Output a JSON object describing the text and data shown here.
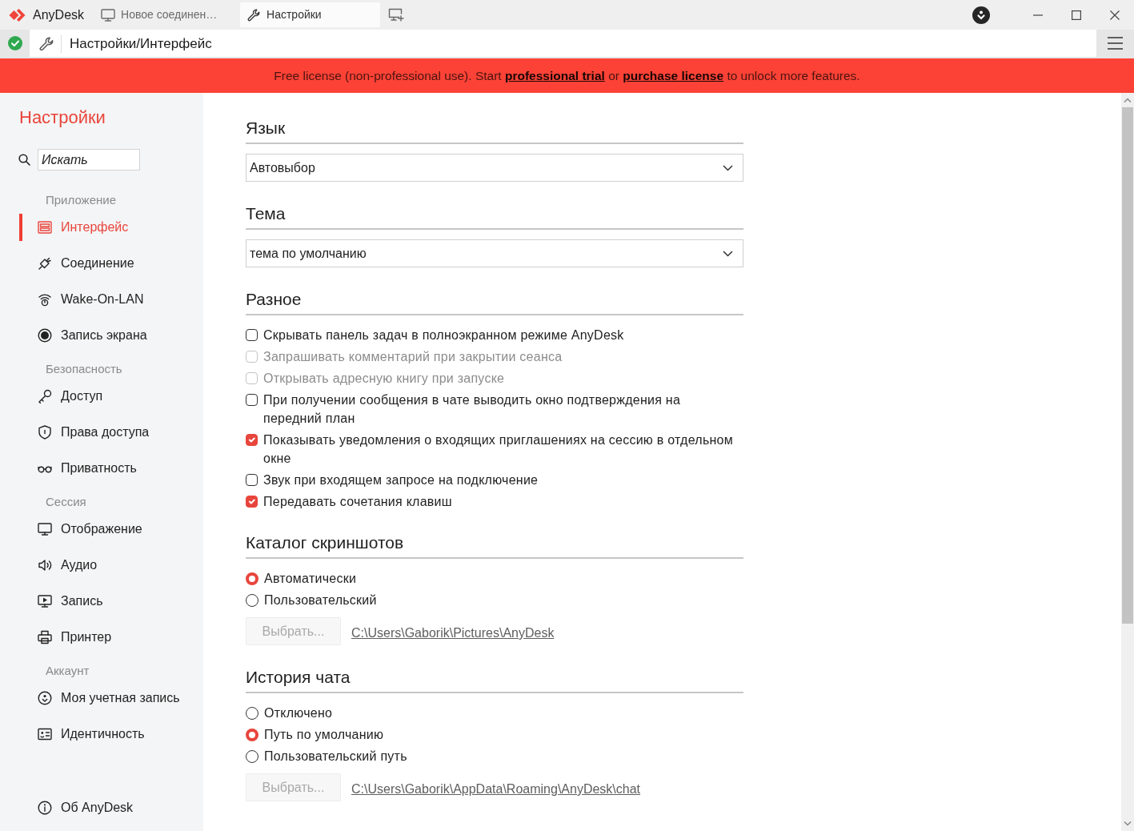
{
  "title_bar": {
    "app_name": "AnyDesk",
    "tabs": [
      {
        "label": "Новое соединен…",
        "selected": false
      },
      {
        "label": "Настройки",
        "selected": true
      }
    ]
  },
  "address_bar": {
    "path": "Настройки/Интерфейс"
  },
  "license_banner": [
    {
      "kind": "text",
      "text": "Free license (non-professional use). Start"
    },
    {
      "kind": "link",
      "text": "professional trial"
    },
    {
      "kind": "text",
      "text": "or"
    },
    {
      "kind": "link",
      "text": "purchase license"
    },
    {
      "kind": "text",
      "text": "to unlock more features."
    }
  ],
  "sidebar": {
    "title": "Настройки",
    "search": {
      "placeholder": "Искать"
    },
    "groups": [
      {
        "label": "Приложение",
        "items": [
          {
            "label": "Интерфейс",
            "selected": true
          },
          {
            "label": "Соединение",
            "selected": false
          },
          {
            "label": "Wake-On-LAN",
            "selected": false
          },
          {
            "label": "Запись экрана",
            "selected": false
          }
        ]
      },
      {
        "label": "Безопасность",
        "items": [
          {
            "label": "Доступ",
            "selected": false
          },
          {
            "label": "Права доступа",
            "selected": false
          },
          {
            "label": "Приватность",
            "selected": false
          }
        ]
      },
      {
        "label": "Сессия",
        "items": [
          {
            "label": "Отображение",
            "selected": false
          },
          {
            "label": "Аудио",
            "selected": false
          },
          {
            "label": "Запись",
            "selected": false
          },
          {
            "label": "Принтер",
            "selected": false
          }
        ]
      },
      {
        "label": "Аккаунт",
        "items": [
          {
            "label": "Моя учетная запись",
            "selected": false
          },
          {
            "label": "Идентичность",
            "selected": false
          }
        ]
      }
    ],
    "footer_item": {
      "label": "Об AnyDesk",
      "selected": false
    }
  },
  "sections": [
    {
      "kind": "dropdown",
      "heading": "Язык",
      "value": "Автовыбор"
    },
    {
      "kind": "dropdown",
      "heading": "Тема",
      "value": "тема по умолчанию"
    },
    {
      "kind": "checkboxes",
      "heading": "Разное",
      "options": [
        {
          "label": "Скрывать панель задач в полноэкранном режиме AnyDesk",
          "checked": false,
          "disabled": false
        },
        {
          "label": "Запрашивать комментарий при закрытии сеанса",
          "checked": false,
          "disabled": true
        },
        {
          "label": "Открывать адресную книгу при запуске",
          "checked": false,
          "disabled": true
        },
        {
          "label": "При получении сообщения в чате выводить окно подтверждения на передний план",
          "checked": false,
          "disabled": false
        },
        {
          "label": "Показывать уведомления о входящих приглашениях на сессию в отдельном окне",
          "checked": true,
          "disabled": false
        },
        {
          "label": "Звук при входящем запросе на подключение",
          "checked": false,
          "disabled": false
        },
        {
          "label": "Передавать сочетания клавиш",
          "checked": true,
          "disabled": false
        }
      ]
    },
    {
      "kind": "radios",
      "heading": "Каталог скриншотов",
      "options": [
        {
          "label": "Автоматически",
          "selected": true
        },
        {
          "label": "Пользовательский",
          "selected": false
        }
      ],
      "browse_button": {
        "label": "Выбрать...",
        "disabled": true
      },
      "path": "C:\\Users\\Gaborik\\Pictures\\AnyDesk"
    },
    {
      "kind": "radios",
      "heading": "История чата",
      "options": [
        {
          "label": "Отключено",
          "selected": false
        },
        {
          "label": "Путь по умолчанию",
          "selected": true
        },
        {
          "label": "Пользовательский путь",
          "selected": false
        }
      ],
      "browse_button": {
        "label": "Выбрать...",
        "disabled": true
      },
      "path": "C:\\Users\\Gaborik\\AppData\\Roaming\\AnyDesk\\chat"
    }
  ]
}
